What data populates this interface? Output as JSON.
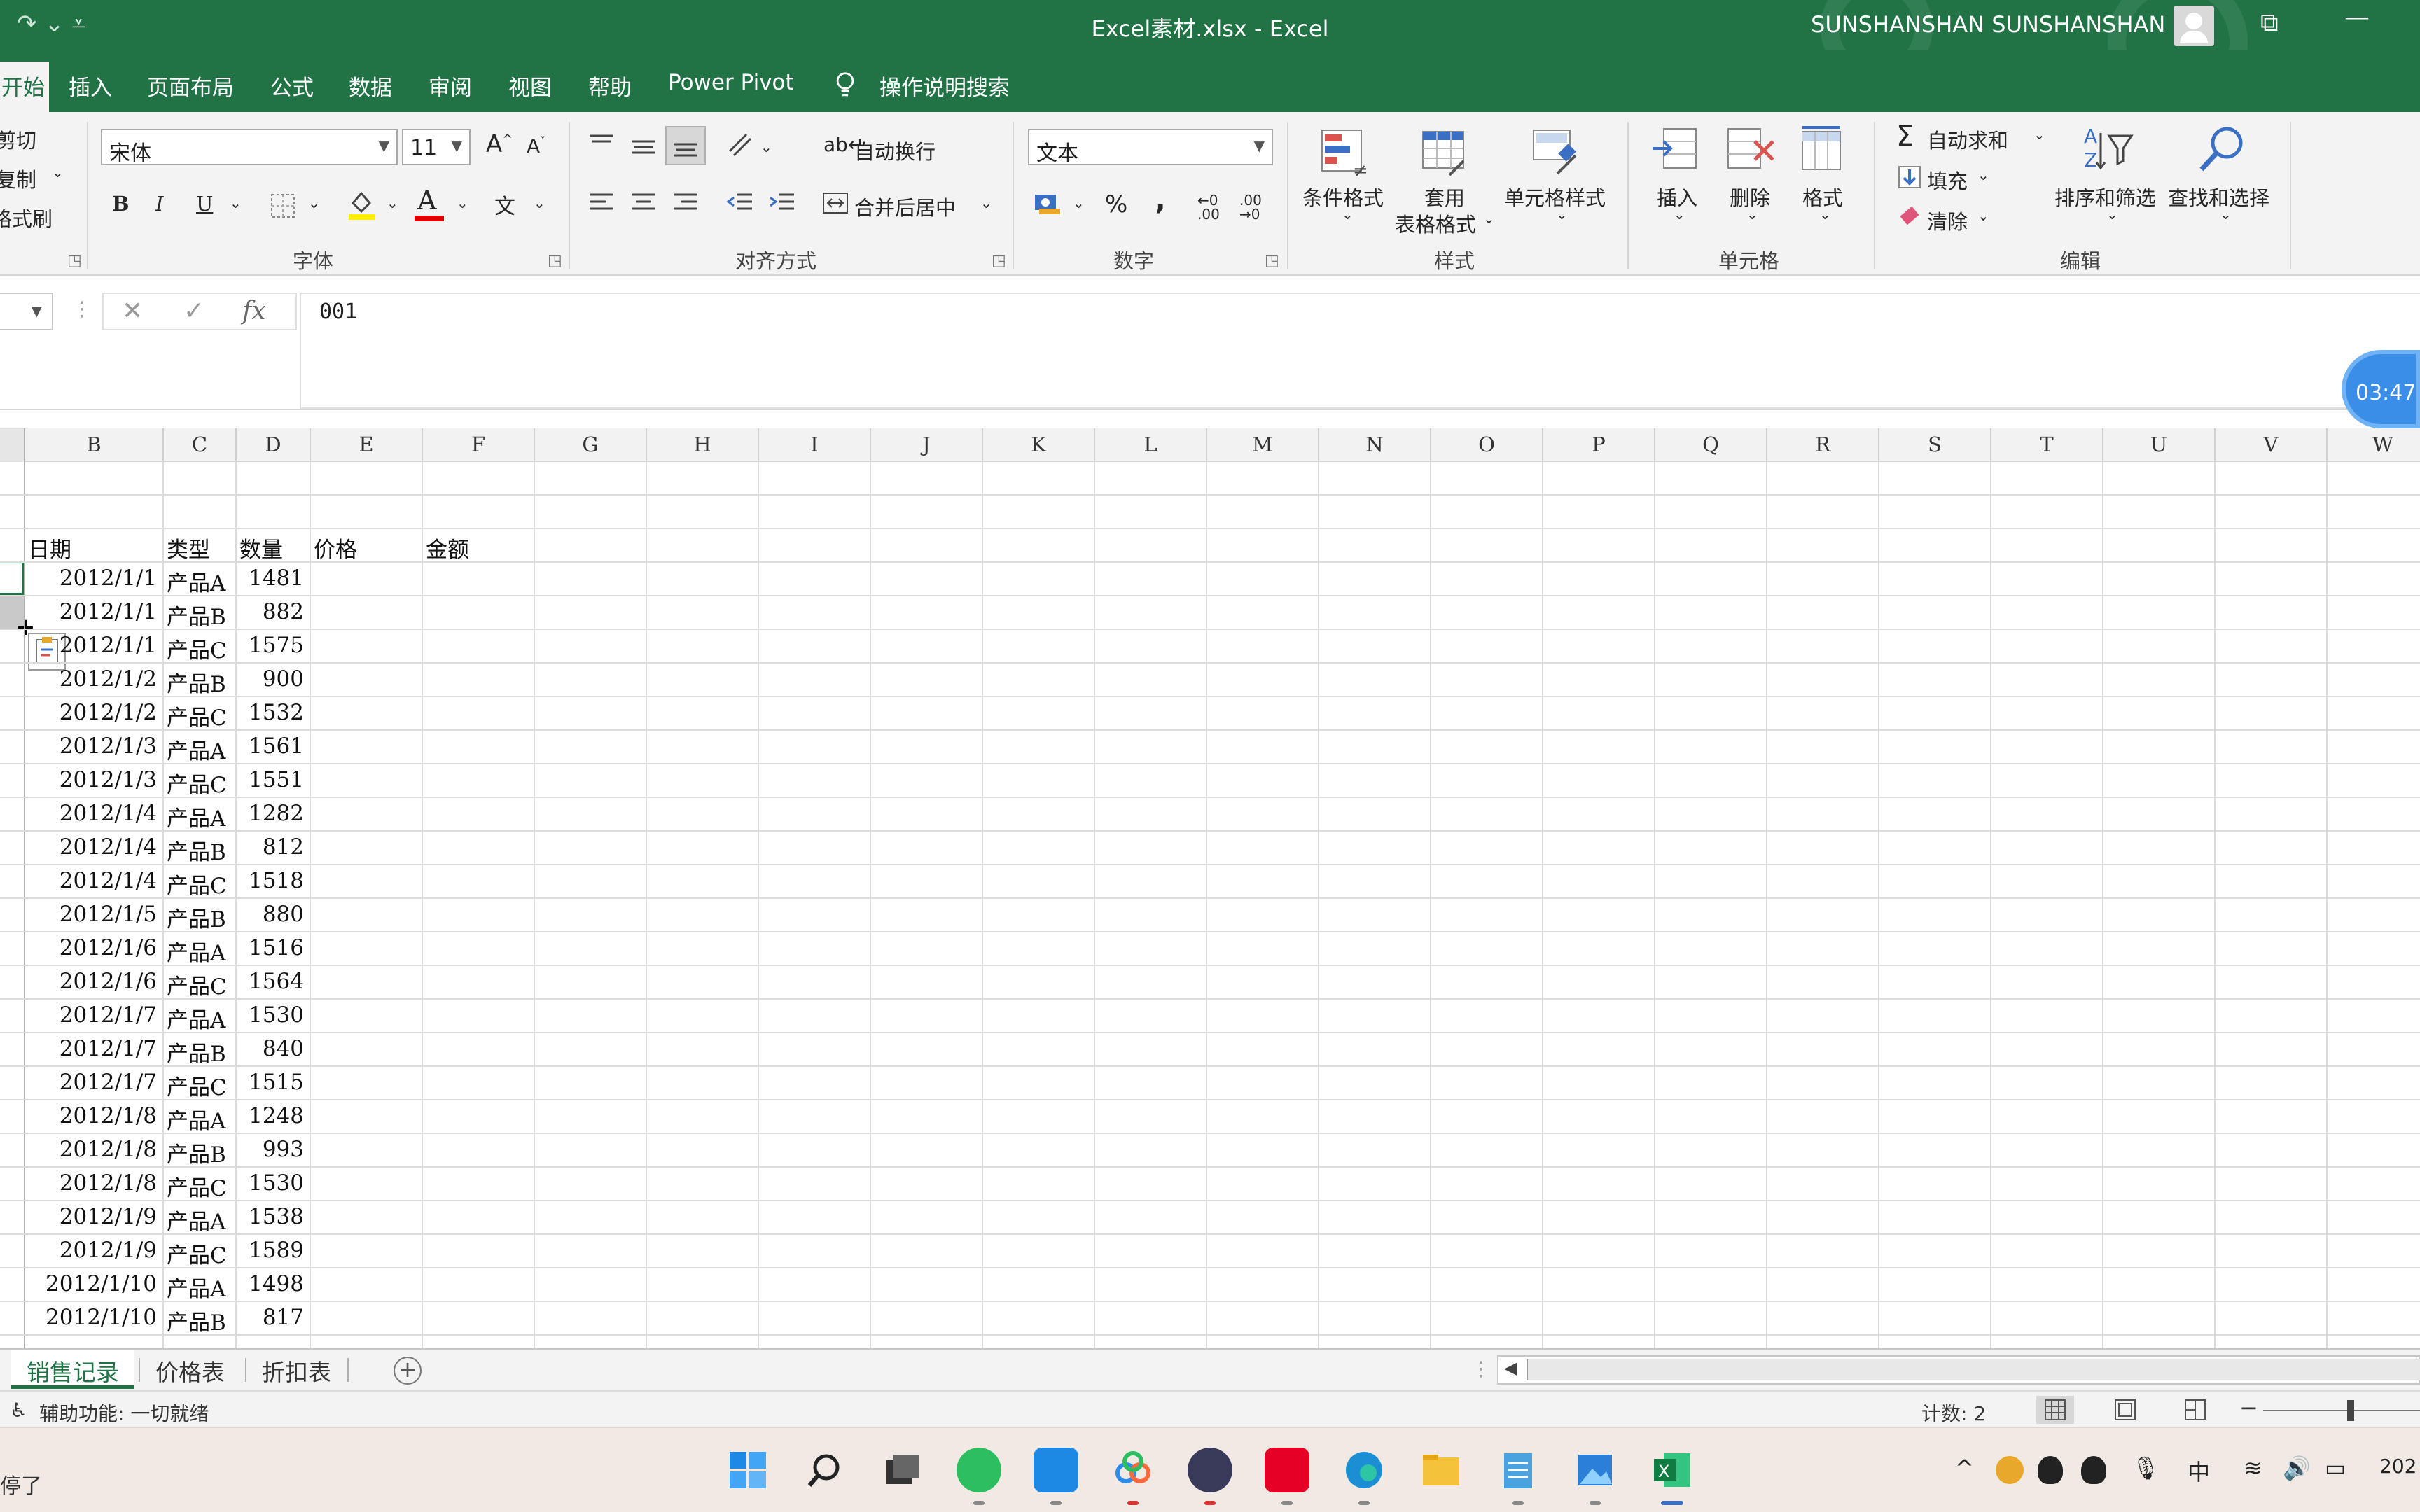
{
  "app": {
    "title": "Excel素材.xlsx  -  Excel",
    "user": "SUNSHANSHAN SUNSHANSHAN"
  },
  "ribbon_tabs": [
    "开始",
    "插入",
    "页面布局",
    "公式",
    "数据",
    "审阅",
    "视图",
    "帮助",
    "Power Pivot"
  ],
  "tell_me": "操作说明搜索",
  "clipboard": {
    "cut": "剪切",
    "copy": "复制",
    "format_painter": "格式刷"
  },
  "font": {
    "name": "宋体",
    "size": "11",
    "group_label": "字体",
    "bold": "B",
    "italic": "I",
    "underline": "U",
    "font_color_glyph": "A",
    "grow_glyph": "A",
    "shrink_glyph": "A",
    "phonetic_glyph": "文"
  },
  "alignment": {
    "wrap": "自动换行",
    "merge": "合并后居中",
    "group_label": "对齐方式"
  },
  "number": {
    "format": "文本",
    "group_label": "数字",
    "percent": "%",
    "comma": ","
  },
  "styles": {
    "conditional": "条件格式",
    "table_format_1": "套用",
    "table_format_2": "表格格式",
    "cell_styles": "单元格样式",
    "group_label": "样式"
  },
  "cells": {
    "insert": "插入",
    "delete": "删除",
    "format": "格式",
    "group_label": "单元格"
  },
  "editing": {
    "autosum": "自动求和",
    "fill": "填充",
    "clear": "清除",
    "sort": "排序和筛选",
    "find": "查找和选择",
    "group_label": "编辑"
  },
  "formula_bar": {
    "fx": "fx",
    "cancel": "✕",
    "confirm": "✓",
    "value": "001"
  },
  "timer": "03:47",
  "columns": [
    "B",
    "C",
    "D",
    "E",
    "F",
    "G",
    "H",
    "I",
    "J",
    "K",
    "L",
    "M",
    "N",
    "O",
    "P",
    "Q",
    "R",
    "S",
    "T",
    "U",
    "V",
    "W"
  ],
  "table": {
    "headers": [
      "日期",
      "类型",
      "数量",
      "价格",
      "金额"
    ],
    "rows": [
      [
        "2012/1/1",
        "产品A",
        "1481"
      ],
      [
        "2012/1/1",
        "产品B",
        "882"
      ],
      [
        "2012/1/1",
        "产品C",
        "1575"
      ],
      [
        "2012/1/2",
        "产品B",
        "900"
      ],
      [
        "2012/1/2",
        "产品C",
        "1532"
      ],
      [
        "2012/1/3",
        "产品A",
        "1561"
      ],
      [
        "2012/1/3",
        "产品C",
        "1551"
      ],
      [
        "2012/1/4",
        "产品A",
        "1282"
      ],
      [
        "2012/1/4",
        "产品B",
        "812"
      ],
      [
        "2012/1/4",
        "产品C",
        "1518"
      ],
      [
        "2012/1/5",
        "产品B",
        "880"
      ],
      [
        "2012/1/6",
        "产品A",
        "1516"
      ],
      [
        "2012/1/6",
        "产品C",
        "1564"
      ],
      [
        "2012/1/7",
        "产品A",
        "1530"
      ],
      [
        "2012/1/7",
        "产品B",
        "840"
      ],
      [
        "2012/1/7",
        "产品C",
        "1515"
      ],
      [
        "2012/1/8",
        "产品A",
        "1248"
      ],
      [
        "2012/1/8",
        "产品B",
        "993"
      ],
      [
        "2012/1/8",
        "产品C",
        "1530"
      ],
      [
        "2012/1/9",
        "产品A",
        "1538"
      ],
      [
        "2012/1/9",
        "产品C",
        "1589"
      ],
      [
        "2012/1/10",
        "产品A",
        "1498"
      ],
      [
        "2012/1/10",
        "产品B",
        "817"
      ]
    ]
  },
  "sheets": [
    "销售记录",
    "价格表",
    "折扣表"
  ],
  "status": {
    "accessibility": "辅助功能: 一切就绪",
    "count": "计数: 2",
    "zoom_minus": "−"
  },
  "taskbar": {
    "stopped": "停了",
    "ime": "中",
    "date_partial": "202"
  },
  "colors": {
    "excel_green": "#217346",
    "ribbon_bg": "#f3f3f3",
    "taskbar_bg": "#f1e9e3"
  }
}
